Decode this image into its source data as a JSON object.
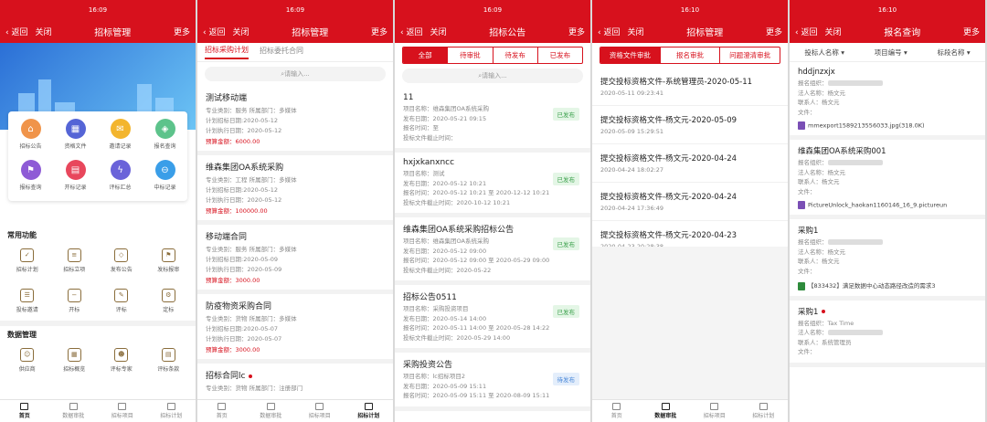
{
  "status_time": [
    "16:09",
    "16:09",
    "16:09",
    "16:10",
    "16:10"
  ],
  "nav": {
    "back": "返回",
    "close": "关闭",
    "more": "更多"
  },
  "phone1": {
    "title": "招标管理",
    "grid": [
      {
        "label": "招标公告",
        "color": "#f0944a",
        "icon": "⌂"
      },
      {
        "label": "资格文件",
        "color": "#5565d6",
        "icon": "▦"
      },
      {
        "label": "邀请记录",
        "color": "#f3b52d",
        "icon": "✉"
      },
      {
        "label": "报名查询",
        "color": "#5dc38b",
        "icon": "◈"
      },
      {
        "label": "报标查询",
        "color": "#8e5bd6",
        "icon": "⚑"
      },
      {
        "label": "开标记录",
        "color": "#e8475c",
        "icon": "▤"
      },
      {
        "label": "评标汇总",
        "color": "#6a63d9",
        "icon": "ϟ"
      },
      {
        "label": "中标记录",
        "color": "#3a9ee8",
        "icon": "⊖"
      }
    ],
    "common_title": "常用功能",
    "common": [
      "招标计划",
      "招标立项",
      "发布公告",
      "发标报审",
      "投标邀请",
      "开标",
      "评标",
      "定标"
    ],
    "data_title": "数据管理",
    "data": [
      "供应商",
      "招标概览",
      "评标专家",
      "评标条款"
    ],
    "tabs": [
      "首页",
      "数据审批",
      "招标项目",
      "招标计划"
    ]
  },
  "phone2": {
    "title": "招标管理",
    "subtabs": [
      "招标采购计划",
      "招标委托合同"
    ],
    "search": "请输入...",
    "items": [
      {
        "title": "测试移动端",
        "r1": "专业类别：服务 所属部门：多媒体",
        "r2": "计划招标日期:2020-05-12",
        "r3": "计划执行日期：2020-05-12",
        "amount": "预算金额：6000.00"
      },
      {
        "title": "维森集团OA系统采购",
        "r1": "专业类别：工程 所属部门：多媒体",
        "r2": "计划招标日期:2020-05-12",
        "r3": "计划执行日期：2020-05-12",
        "amount": "预算金额：100000.00"
      },
      {
        "title": "移动端合同",
        "r1": "专业类别：服务 所属部门：多媒体",
        "r2": "计划招标日期:2020-05-09",
        "r3": "计划执行日期：2020-05-09",
        "amount": "预算金额：3000.00"
      },
      {
        "title": "防疫物资采购合同",
        "r1": "专业类别：货物 所属部门：多媒体",
        "r2": "计划招标日期:2020-05-07",
        "r3": "计划执行日期：2020-05-07",
        "amount": "预算金额：3000.00"
      },
      {
        "title": "招标合同lc",
        "r1": "专业类别：货物 所属部门：注册部门",
        "r2": "",
        "r3": "",
        "amount": ""
      }
    ],
    "tabs": [
      "首页",
      "数据审批",
      "招标项目",
      "招标计划"
    ]
  },
  "phone3": {
    "title": "招标公告",
    "seg": [
      "全部",
      "待审批",
      "待发布",
      "已发布"
    ],
    "search": "请输入...",
    "items": [
      {
        "title": "11",
        "r1": "项目名称：维森集团OA系统采购",
        "r2": "发布日期：2020-05-21 09:15",
        "r3": "报名时间：至",
        "r4": "投标文件截止时间：",
        "badge": "已发布"
      },
      {
        "title": "hxjxkanxncc",
        "r1": "项目名称：测试",
        "r2": "发布日期：2020-05-12 10:21",
        "r3": "报名时间：2020-05-12 10:21 至 2020-12-12 10:21",
        "r4": "投标文件截止时间：2020-10-12 10:21",
        "badge": "已发布"
      },
      {
        "title": "维森集团OA系统采购招标公告",
        "r1": "项目名称：维森集团OA系统采购",
        "r2": "发布日期：2020-05-12 09:00",
        "r3": "报名时间：2020-05-12 09:00 至 2020-05-29 09:00",
        "r4": "投标文件截止时间：2020-05-22",
        "badge": "已发布"
      },
      {
        "title": "招标公告0511",
        "r1": "项目名称：采购投资项目",
        "r2": "发布日期：2020-05-14 14:00",
        "r3": "报名时间：2020-05-11 14:00 至 2020-05-28 14:22",
        "r4": "投标文件截止时间：2020-05-29 14:00",
        "badge": "已发布"
      },
      {
        "title": "采购投资公告",
        "r1": "项目名称：lc招标项目2",
        "r2": "发布日期：2020-05-09 15:11",
        "r3": "报名时间：2020-05-09 15:11 至 2020-08-09 15:11",
        "r4": "",
        "badge": "待发布"
      }
    ]
  },
  "phone4": {
    "title": "招标管理",
    "seg": [
      "资格文件审批",
      "报名审批",
      "问题澄清审批"
    ],
    "files": [
      {
        "title": "提交投标资格文件-系统管理员-2020-05-11",
        "date": "2020-05-11 09:23:41"
      },
      {
        "title": "提交投标资格文件-杨文元-2020-05-09",
        "date": "2020-05-09 15:29:51"
      },
      {
        "title": "提交投标资格文件-杨文元-2020-04-24",
        "date": "2020-04-24 18:02:27"
      },
      {
        "title": "提交投标资格文件-杨文元-2020-04-24",
        "date": "2020-04-24 17:36:49"
      },
      {
        "title": "提交投标资格文件-杨文元-2020-04-23",
        "date": "2020-04-23 20:28:38"
      }
    ],
    "tabs": [
      "首页",
      "数据审批",
      "招标项目",
      "招标计划"
    ]
  },
  "phone5": {
    "title": "报名查询",
    "filters": [
      "投标人名称 ▾",
      "项目编号 ▾",
      "标段名称 ▾"
    ],
    "items": [
      {
        "title": "hddjnzxjx",
        "org": "报名组织：",
        "legal": "法人名称：杨文元",
        "contact": "联系人：杨文元",
        "file": "文件：",
        "att": "mmexport1589213556033.jpg(318.0K)",
        "attColor": "purple"
      },
      {
        "title": "维森集团OA系统采购001",
        "org": "报名组织：",
        "legal": "法人名称：杨文元",
        "contact": "联系人：杨文元",
        "file": "文件：",
        "att": "PictureUnlock_haokan1160146_16_9.pictureun",
        "attColor": "purple"
      },
      {
        "title": "采购1",
        "org": "报名组织：",
        "legal": "法人名称：杨文元",
        "contact": "联系人：杨文元",
        "file": "文件：",
        "att": "【833432】满足数据中心动态路径改造的需求3",
        "attColor": "green"
      },
      {
        "title": "采购1",
        "org": "报名组织：Tax Time",
        "legal": "法人名称：",
        "contact": "联系人：系统管理员",
        "file": "文件：",
        "att": "",
        "attColor": ""
      }
    ]
  }
}
